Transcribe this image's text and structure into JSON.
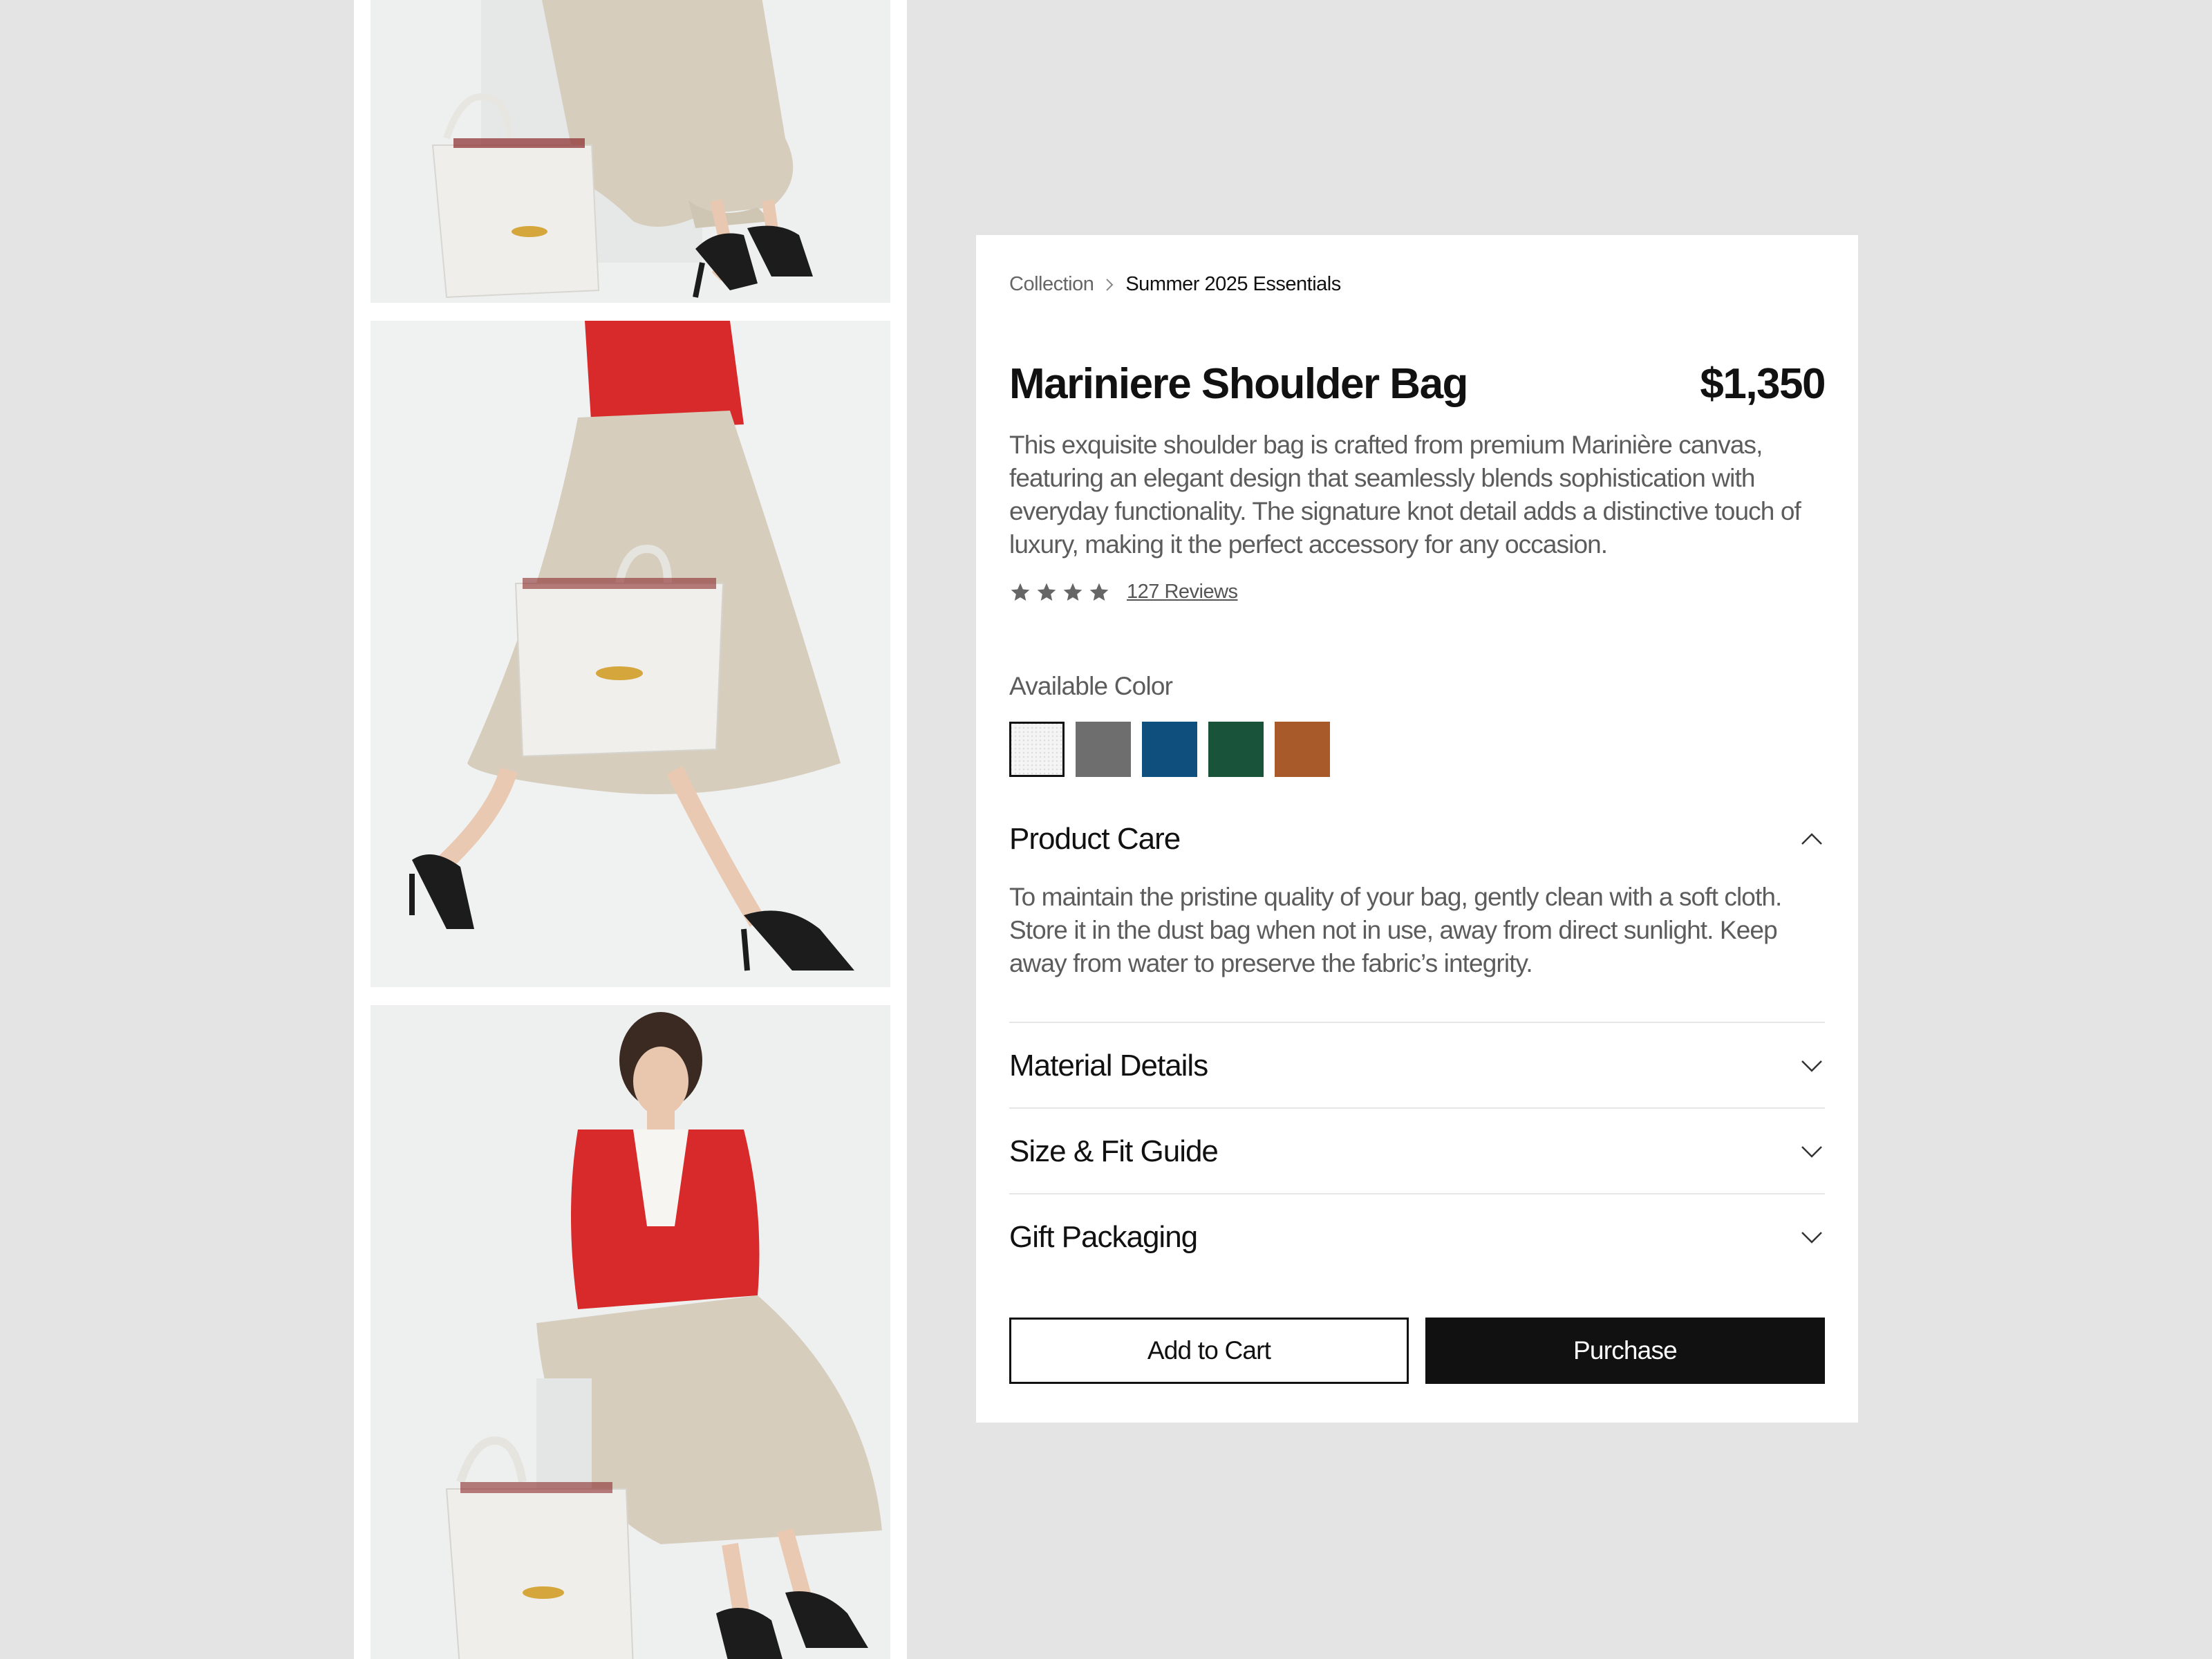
{
  "breadcrumb": {
    "items": [
      "Collection",
      "Summer 2025 Essentials"
    ]
  },
  "product": {
    "title": "Mariniere Shoulder Bag",
    "price": "$1,350",
    "description": "This exquisite shoulder bag is crafted from premium Marinière canvas, featuring an elegant design that seamlessly blends sophistication with everyday functionality. The signature knot detail adds a distinctive touch of luxury, making it the perfect accessory for any occasion.",
    "rating": 4,
    "reviews_label": "127 Reviews"
  },
  "colors": {
    "label": "Available Color",
    "options": [
      "#f4f4f4",
      "#6e6e6e",
      "#0f4f7e",
      "#19543a",
      "#a85a2a"
    ],
    "selected_index": 0
  },
  "accordion": {
    "product_care": {
      "title": "Product Care",
      "body": "To maintain the pristine quality of your bag, gently clean with a soft cloth. Store it in the dust bag when not in use, away from direct sunlight. Keep away from water to preserve the fabric’s integrity.",
      "icon": "chevron-up-icon"
    },
    "material_details": {
      "title": "Material Details",
      "icon": "chevron-down-icon"
    },
    "size_fit": {
      "title": "Size & Fit Guide",
      "icon": "chevron-down-icon"
    },
    "gift_packaging": {
      "title": "Gift Packaging",
      "icon": "chevron-down-icon"
    }
  },
  "actions": {
    "add_to_cart": "Add to Cart",
    "purchase": "Purchase"
  },
  "gallery": {
    "photos": [
      "product-photo-seated",
      "product-photo-walking",
      "product-photo-model-seated"
    ]
  }
}
